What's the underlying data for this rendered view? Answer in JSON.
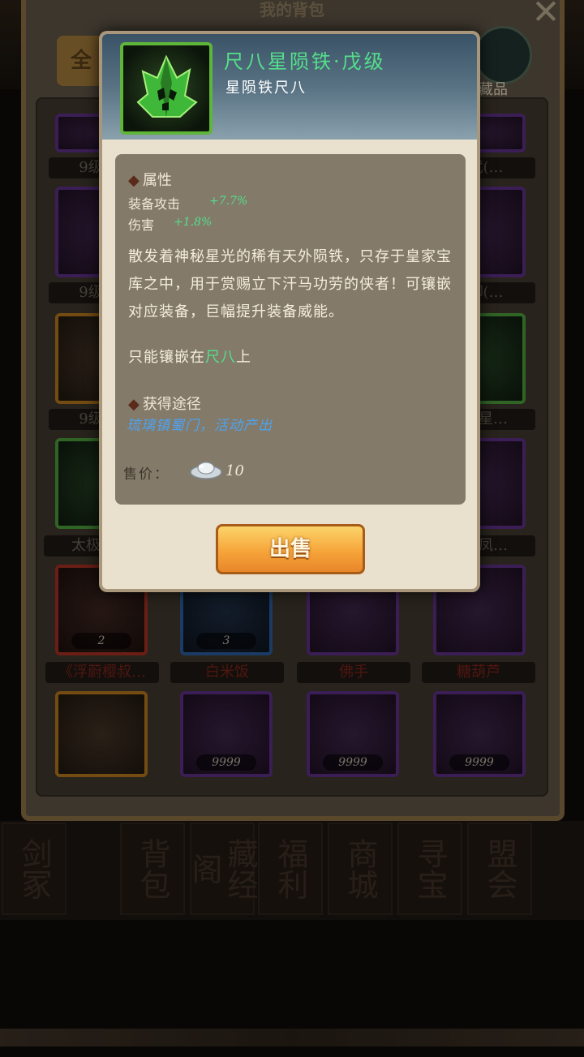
{
  "background": {
    "title": "我的背包",
    "close_icon": "close-x-icon",
    "tab_all_label": "全",
    "collect_label": "藏品",
    "grid": {
      "row1_names": [
        "9级闪…",
        "…武(…"
      ],
      "row2_names": [
        "9级石…",
        "…御(…"
      ],
      "row3_names": [
        "9级皇…",
        "…衣星…"
      ],
      "row4_names": [
        "太极扶…",
        "…双凤…"
      ],
      "row5": [
        {
          "name": "《浮蔚樱叔…",
          "count": "2"
        },
        {
          "name": "白米饭",
          "count": "3"
        },
        {
          "name": "佛手",
          "count": ""
        },
        {
          "name": "糖葫芦",
          "count": ""
        }
      ],
      "row6_counts": [
        "",
        "9999",
        "9999",
        "9999"
      ]
    },
    "nav_tabs": [
      "剑冢",
      "背包",
      "藏经阁",
      "福利",
      "商城",
      "寻宝",
      "盟会"
    ]
  },
  "popup": {
    "item_name": "尺八星陨铁·戊级",
    "item_subtitle": "星陨铁尺八",
    "icon": "green-crystal-icon",
    "attributes_title": "属性",
    "attributes": [
      {
        "label": "装备攻击",
        "value": "+7.7%"
      },
      {
        "label": "伤害",
        "value": "+1.8%"
      }
    ],
    "description": "散发着神秘星光的稀有天外陨铁，只存于皇家宝库之中，用于赏赐立下汗马功劳的侠者！可镶嵌对应装备，巨幅提升装备威能。",
    "mount_prefix": "只能镶嵌在",
    "mount_target": "尺八",
    "mount_suffix": "上",
    "source_title": "获得途径",
    "source_text": "琉璃镇蜀门，活动产出",
    "price_label": "售价：",
    "price_value": "10",
    "currency_icon": "silver-ingot-icon",
    "sell_button": "出售"
  },
  "colors": {
    "item_name": "#54e08b",
    "source_link": "#4ea3f0",
    "sell_button": "#f6a53a"
  }
}
